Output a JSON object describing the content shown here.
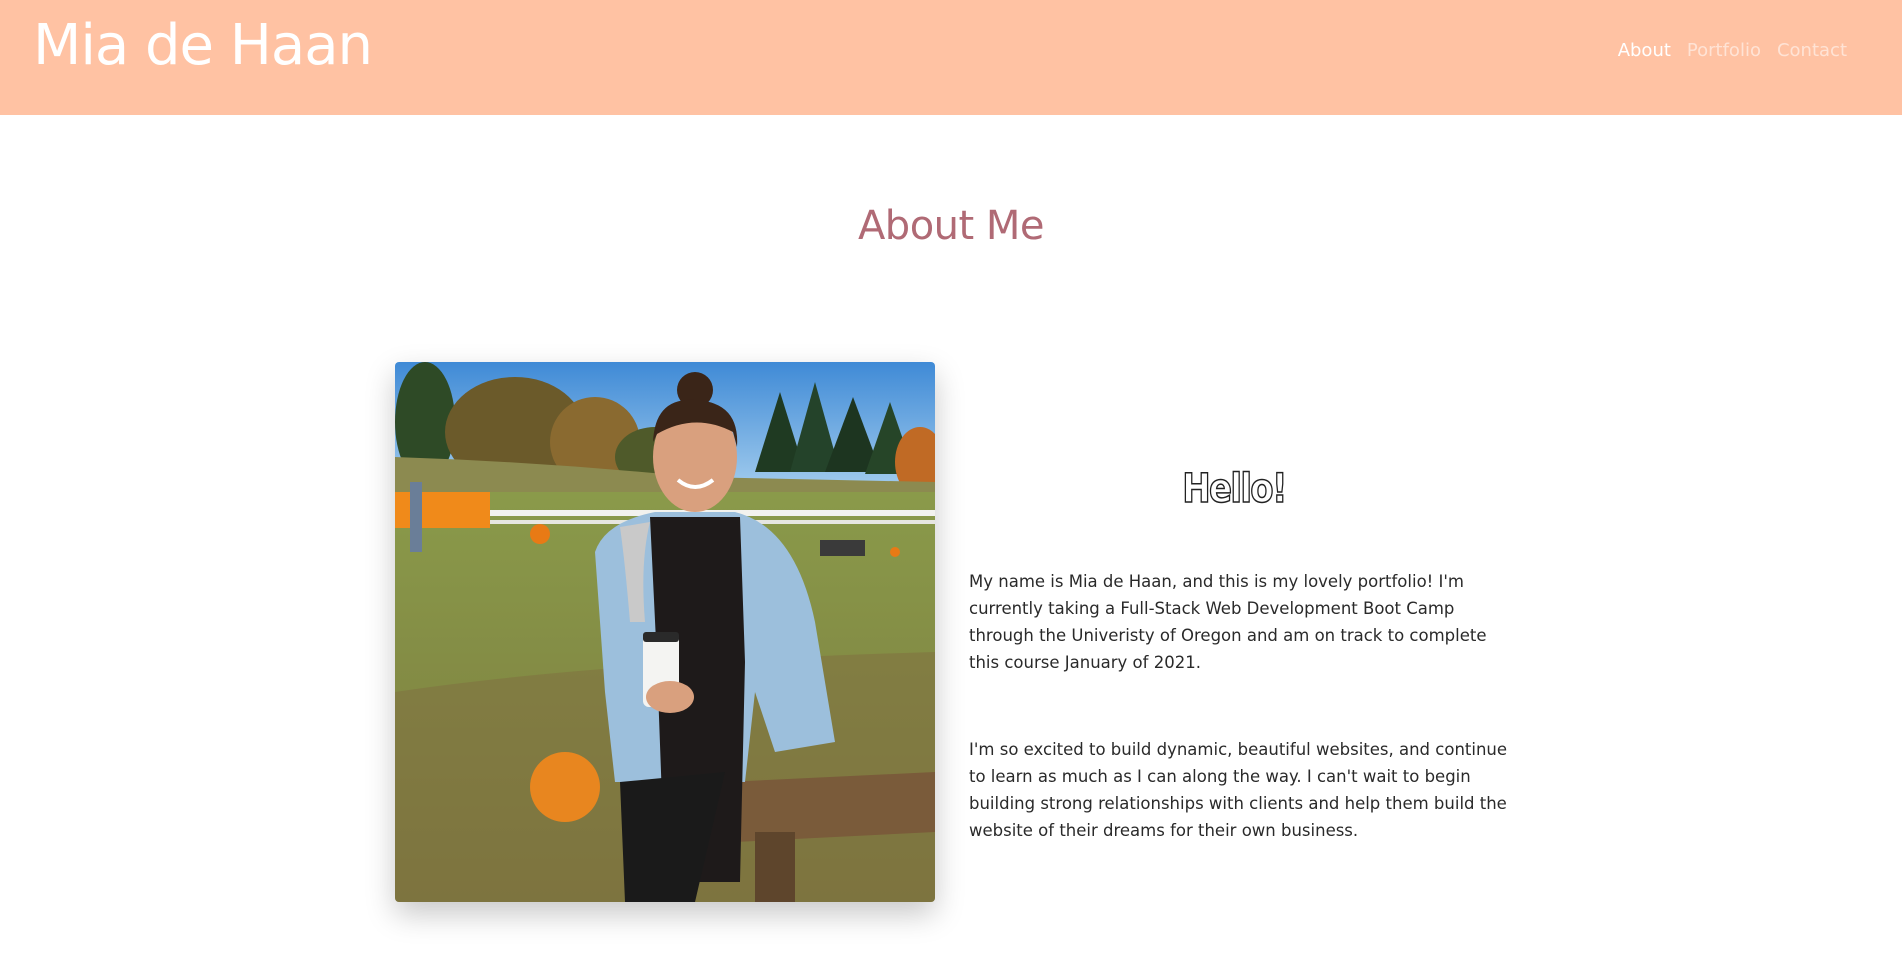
{
  "header": {
    "site_title": "Mia de Haan",
    "background_color": "#ffc2a3",
    "nav": [
      {
        "label": "About",
        "active": true
      },
      {
        "label": "Portfolio",
        "active": false
      },
      {
        "label": "Contact",
        "active": false
      }
    ]
  },
  "main": {
    "heading": "About Me",
    "heading_color": "#b06a75",
    "photo": {
      "subject": "Woman sitting on a bench at a pumpkin patch holding a cup"
    },
    "hello": "Hello!",
    "paragraphs": [
      "My name is Mia de Haan, and this is my lovely portfolio! I'm currently taking a Full-Stack Web Development Boot Camp through the Univeristy of Oregon and am on track to complete this course January of 2021.",
      "I'm so excited to build dynamic, beautiful websites, and continue to learn as much as I can along the way. I can't wait to begin building strong relationships with clients and help them build the website of their dreams for their own business."
    ]
  }
}
